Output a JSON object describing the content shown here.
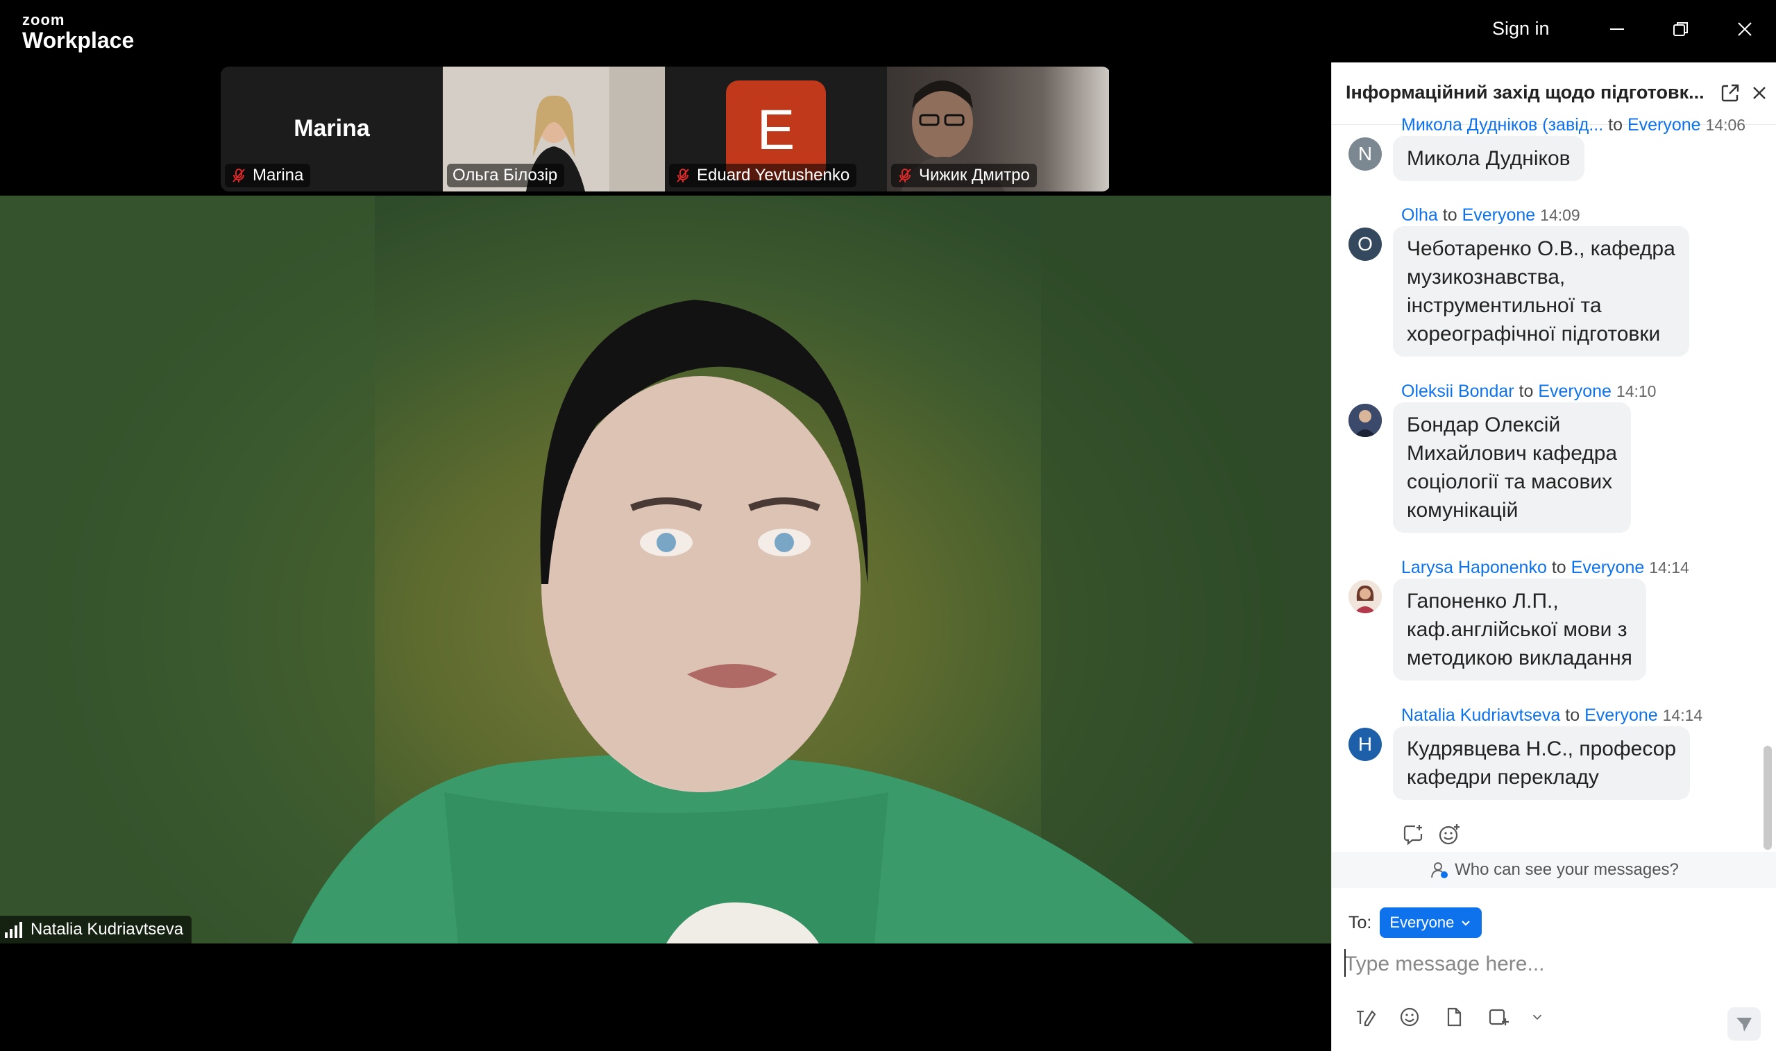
{
  "app": {
    "logo_top": "zoom",
    "logo_bottom": "Workplace",
    "sign_in": "Sign in"
  },
  "gallery": [
    {
      "name": "Marina",
      "label": "Marina",
      "muted": true,
      "display_name_center": "Marina"
    },
    {
      "name": "Ольга Білозір",
      "label": "Ольга Білозір",
      "muted": false
    },
    {
      "name": "Eduard Yevtushenko",
      "label": "Eduard Yevtushenko",
      "muted": true,
      "avatar_letter": "E",
      "avatar_color": "#c0391b"
    },
    {
      "name": "Чижик Дмитро",
      "label": "Чижик Дмитро",
      "muted": true
    }
  ],
  "main_video": {
    "speaker": "Natalia Kudriavtseva"
  },
  "chat": {
    "title": "Інформаційний захід щодо підготовк...",
    "messages": [
      {
        "sender": "Микола Дудніков (завід...",
        "to": "to",
        "target": "Everyone",
        "time": "14:06",
        "avatar": "N",
        "avatar_color": "#7b8791",
        "text": "Микола Дудніков"
      },
      {
        "sender": "Olha",
        "to": "to",
        "target": "Everyone",
        "time": "14:09",
        "avatar": "O",
        "avatar_color": "#34495e",
        "text": "Чеботаренко О.В., кафедра\nмузикознавства,\nінструментильної та\nхореографічної підготовки"
      },
      {
        "sender": "Oleksii Bondar",
        "to": "to",
        "target": "Everyone",
        "time": "14:10",
        "avatar": "",
        "avatar_color": "#3b4a6b",
        "text": "Бондар Олексій\nМихайлович кафедра\nсоціології та масових\nкомунікацій"
      },
      {
        "sender": "Larysa Haponenko",
        "to": "to",
        "target": "Everyone",
        "time": "14:14",
        "avatar": "",
        "avatar_color": "#b07a5a",
        "text": "Гапоненко Л.П.,\nкаф.англійської мови з\nметодикою викладання"
      },
      {
        "sender": "Natalia Kudriavtseva",
        "to": "to",
        "target": "Everyone",
        "time": "14:14",
        "avatar": "Н",
        "avatar_color": "#1d5fa8",
        "text": "Кудрявцева Н.С., професор\nкафедри перекладу"
      }
    ],
    "who_can_see": "Who can see your messages?",
    "to_label": "To:",
    "to_value": "Everyone",
    "compose_placeholder": "Type message here..."
  },
  "colors": {
    "accent": "#0e72ed",
    "bubble": "#f1f2f4",
    "mute_red": "#e02828"
  }
}
